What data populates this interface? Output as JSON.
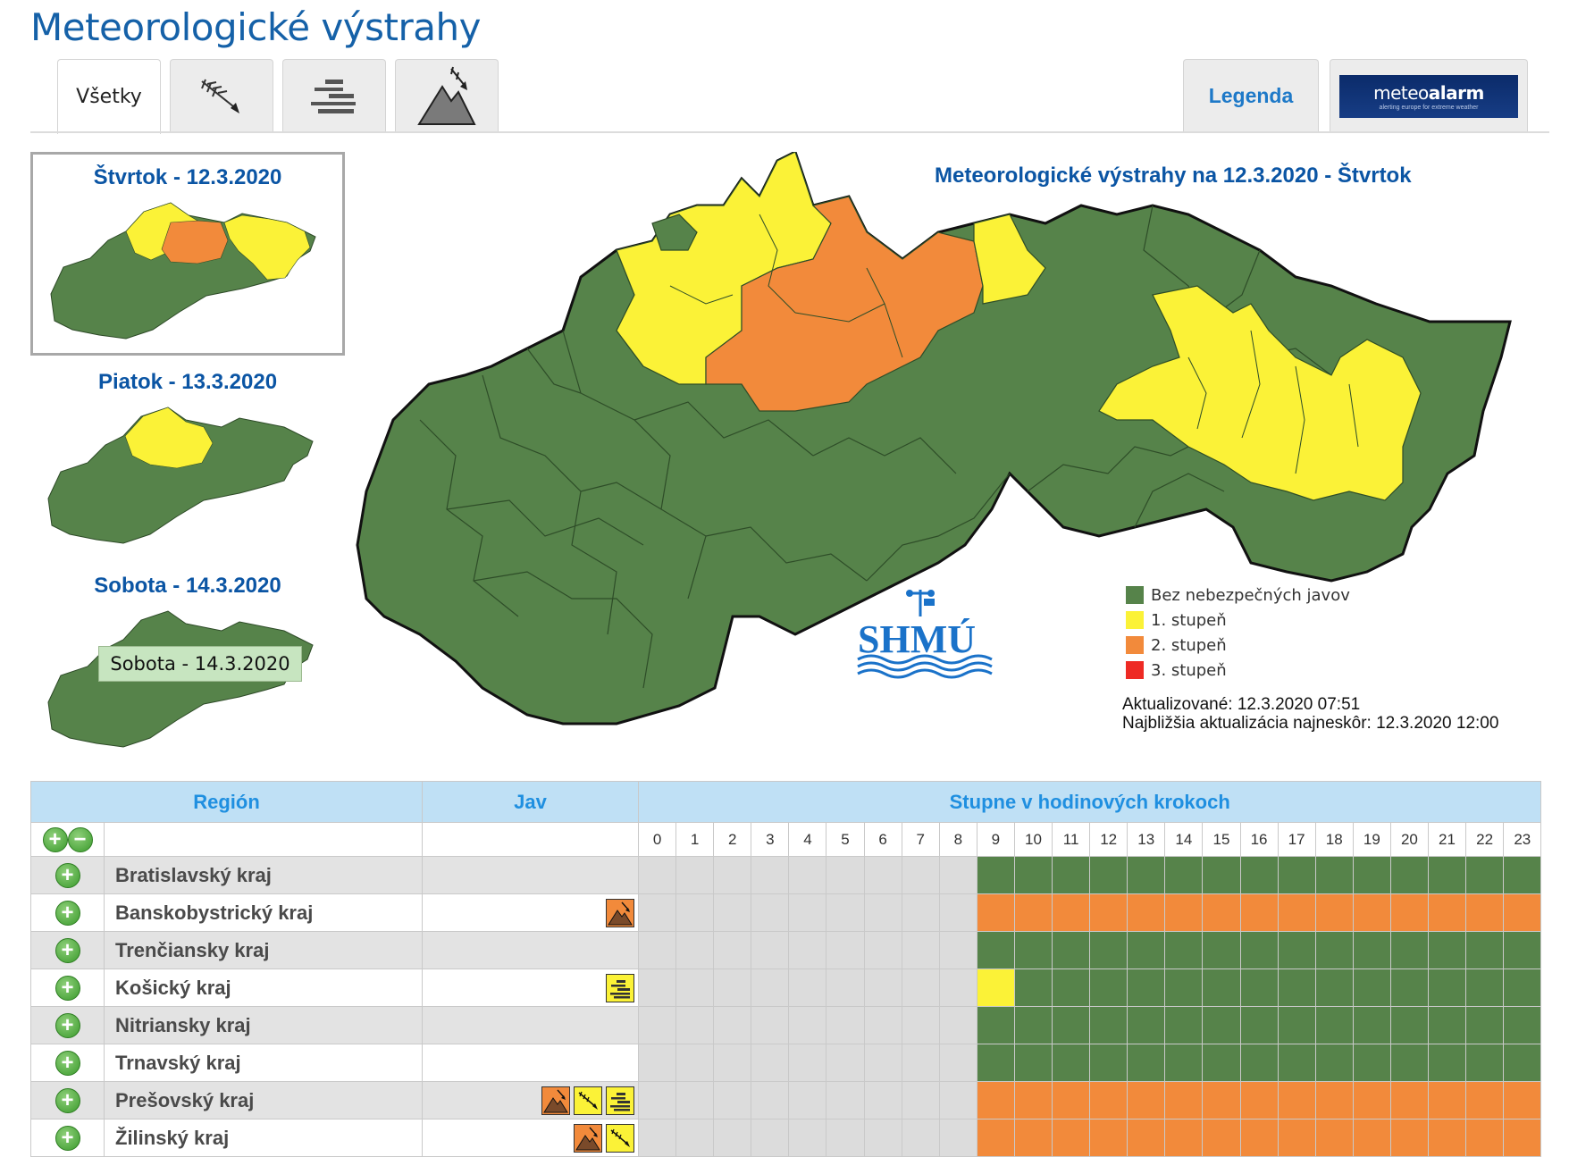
{
  "page": {
    "title": "Meteorologické výstrahy"
  },
  "tabs": [
    {
      "label": "Všetky",
      "icon": "all-warnings"
    },
    {
      "icon": "wind-icon"
    },
    {
      "icon": "fog-icon"
    },
    {
      "icon": "mountain-wind-icon"
    }
  ],
  "legend_tab": {
    "label": "Legenda"
  },
  "meteoalarm": {
    "main": "meteo",
    "bold": "alarm",
    "sub": "alerting europe for extreme weather"
  },
  "days": [
    {
      "label": "Štvrtok - 12.3.2020",
      "selected": true
    },
    {
      "label": "Piatok - 13.3.2020",
      "selected": false
    },
    {
      "label": "Sobota - 14.3.2020",
      "selected": false
    }
  ],
  "tooltip": "Sobota - 14.3.2020",
  "map": {
    "title": "Meteorologické výstrahy na 12.3.2020 - Štvrtok",
    "logo": "SHMÚ"
  },
  "legend": [
    {
      "label": "Bez nebezpečných javov",
      "color": "#56834a"
    },
    {
      "label": "1. stupeň",
      "color": "#fbf237"
    },
    {
      "label": "2. stupeň",
      "color": "#f28a3b"
    },
    {
      "label": "3. stupeň",
      "color": "#ee2a24"
    }
  ],
  "update": {
    "updated": "Aktualizované: 12.3.2020 07:51",
    "next": "Najbližšia aktualizácia najneskôr: 12.3.2020 12:00"
  },
  "colors": {
    "green": "#56834a",
    "yellow": "#fbf237",
    "orange": "#f28a3b",
    "grey": "#dcdcdc"
  },
  "table": {
    "headers": {
      "region": "Región",
      "jav": "Jav",
      "steps": "Stupne v hodinových krokoch"
    },
    "hours": [
      "0",
      "1",
      "2",
      "3",
      "4",
      "5",
      "6",
      "7",
      "8",
      "9",
      "10",
      "11",
      "12",
      "13",
      "14",
      "15",
      "16",
      "17",
      "18",
      "19",
      "20",
      "21",
      "22",
      "23"
    ],
    "rows": [
      {
        "region": "Bratislavský kraj",
        "icons": [],
        "levels": [
          "grey",
          "grey",
          "grey",
          "grey",
          "grey",
          "grey",
          "grey",
          "grey",
          "grey",
          "green",
          "green",
          "green",
          "green",
          "green",
          "green",
          "green",
          "green",
          "green",
          "green",
          "green",
          "green",
          "green",
          "green",
          "green"
        ]
      },
      {
        "region": "Banskobystrický kraj",
        "icons": [
          {
            "type": "mountain-wind-icon",
            "level": "orange"
          }
        ],
        "levels": [
          "grey",
          "grey",
          "grey",
          "grey",
          "grey",
          "grey",
          "grey",
          "grey",
          "grey",
          "orange",
          "orange",
          "orange",
          "orange",
          "orange",
          "orange",
          "orange",
          "orange",
          "orange",
          "orange",
          "orange",
          "orange",
          "orange",
          "orange",
          "orange"
        ]
      },
      {
        "region": "Trenčiansky kraj",
        "icons": [],
        "levels": [
          "grey",
          "grey",
          "grey",
          "grey",
          "grey",
          "grey",
          "grey",
          "grey",
          "grey",
          "green",
          "green",
          "green",
          "green",
          "green",
          "green",
          "green",
          "green",
          "green",
          "green",
          "green",
          "green",
          "green",
          "green",
          "green"
        ]
      },
      {
        "region": "Košický kraj",
        "icons": [
          {
            "type": "fog-icon",
            "level": "yellow"
          }
        ],
        "levels": [
          "grey",
          "grey",
          "grey",
          "grey",
          "grey",
          "grey",
          "grey",
          "grey",
          "grey",
          "yellow",
          "green",
          "green",
          "green",
          "green",
          "green",
          "green",
          "green",
          "green",
          "green",
          "green",
          "green",
          "green",
          "green",
          "green"
        ]
      },
      {
        "region": "Nitriansky kraj",
        "icons": [],
        "levels": [
          "grey",
          "grey",
          "grey",
          "grey",
          "grey",
          "grey",
          "grey",
          "grey",
          "grey",
          "green",
          "green",
          "green",
          "green",
          "green",
          "green",
          "green",
          "green",
          "green",
          "green",
          "green",
          "green",
          "green",
          "green",
          "green"
        ]
      },
      {
        "region": "Trnavský kraj",
        "icons": [],
        "levels": [
          "grey",
          "grey",
          "grey",
          "grey",
          "grey",
          "grey",
          "grey",
          "grey",
          "grey",
          "green",
          "green",
          "green",
          "green",
          "green",
          "green",
          "green",
          "green",
          "green",
          "green",
          "green",
          "green",
          "green",
          "green",
          "green"
        ]
      },
      {
        "region": "Prešovský kraj",
        "icons": [
          {
            "type": "mountain-wind-icon",
            "level": "orange"
          },
          {
            "type": "wind-icon",
            "level": "yellow"
          },
          {
            "type": "fog-icon",
            "level": "yellow"
          }
        ],
        "levels": [
          "grey",
          "grey",
          "grey",
          "grey",
          "grey",
          "grey",
          "grey",
          "grey",
          "grey",
          "orange",
          "orange",
          "orange",
          "orange",
          "orange",
          "orange",
          "orange",
          "orange",
          "orange",
          "orange",
          "orange",
          "orange",
          "orange",
          "orange",
          "orange"
        ]
      },
      {
        "region": "Žilinský kraj",
        "icons": [
          {
            "type": "mountain-wind-icon",
            "level": "orange"
          },
          {
            "type": "wind-icon",
            "level": "yellow"
          }
        ],
        "levels": [
          "grey",
          "grey",
          "grey",
          "grey",
          "grey",
          "grey",
          "grey",
          "grey",
          "grey",
          "orange",
          "orange",
          "orange",
          "orange",
          "orange",
          "orange",
          "orange",
          "orange",
          "orange",
          "orange",
          "orange",
          "orange",
          "orange",
          "orange",
          "orange"
        ]
      }
    ]
  }
}
